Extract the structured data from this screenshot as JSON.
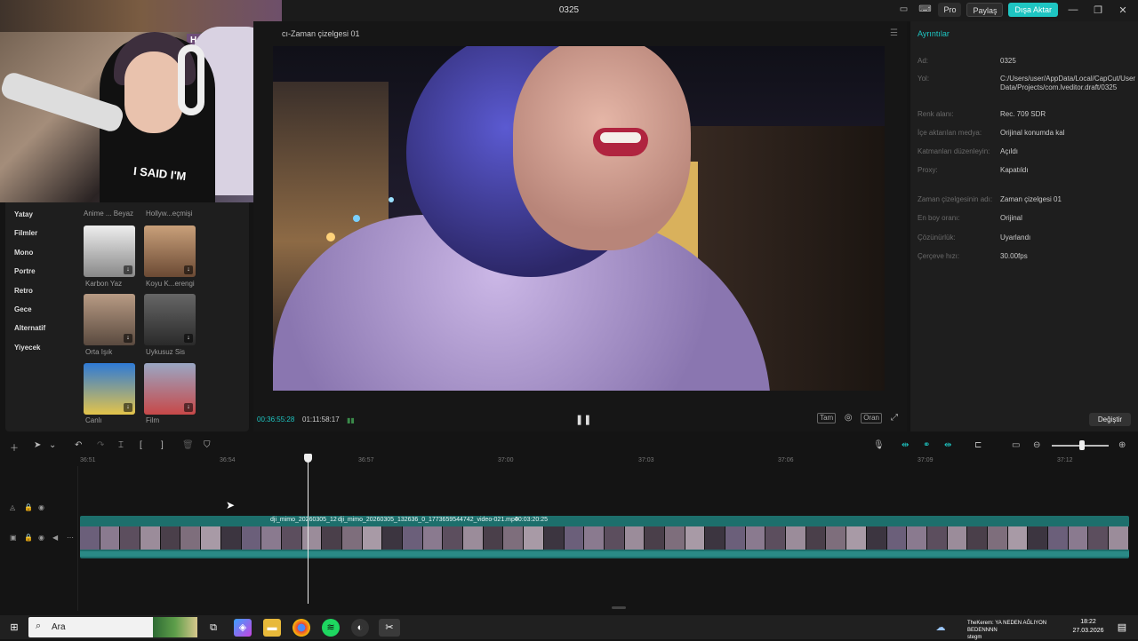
{
  "window": {
    "title": "0325",
    "pro_label": "Pro",
    "share_label": "Paylaş",
    "export_label": "Dışa Aktar"
  },
  "webcam": {
    "shirt_text": "I SAID I'M",
    "poster_text": "HAWK"
  },
  "filters": {
    "categories": [
      "Yatay",
      "Filmler",
      "Mono",
      "Portre",
      "Retro",
      "Gece",
      "Alternatif",
      "Yiyecek"
    ],
    "top_labels": [
      "Anime ... Beyaz",
      "Hollyw...eçmişi"
    ],
    "items": [
      {
        "label": "Karbon Yaz"
      },
      {
        "label": "Koyu K...erengi"
      },
      {
        "label": "Orta Işık"
      },
      {
        "label": "Uykusuz Sis"
      },
      {
        "label": "Canlı"
      },
      {
        "label": "Film"
      }
    ]
  },
  "preview": {
    "title": "cı-Zaman çizelgesi 01",
    "current_time": "00:36:55:28",
    "duration": "01:11:58:17",
    "full_label": "Tam",
    "ratio_label": "Oran"
  },
  "details": {
    "tab": "Ayrıntılar",
    "rows": [
      {
        "key": "Ad:",
        "value": "0325"
      },
      {
        "key": "Yol:",
        "value": "C:/Users/user/AppData/Local/CapCut/User Data/Projects/com.lveditor.draft/0325"
      },
      {
        "key": "Renk alanı:",
        "value": "Rec. 709 SDR"
      },
      {
        "key": "İçe aktarılan medya:",
        "value": "Orijinal konumda kal"
      },
      {
        "key": "Katmanları düzenleyin:",
        "value": "Açıldı"
      },
      {
        "key": "Proxy:",
        "value": "Kapatıldı"
      },
      {
        "key": "Zaman çizelgesinin adı:",
        "value": "Zaman çizelgesi 01"
      },
      {
        "key": "En boy oranı:",
        "value": "Orijinal"
      },
      {
        "key": "Çözünürlük:",
        "value": "Uyarlandı"
      },
      {
        "key": "Çerçeve hızı:",
        "value": "30.00fps"
      }
    ],
    "change_button": "Değiştir"
  },
  "timeline": {
    "ticks": [
      "36:51",
      "36:54",
      "36:57",
      "37:00",
      "37:03",
      "37:06",
      "37:09",
      "37:12"
    ],
    "clip_label_1": "dji_mimo_20260305_12",
    "clip_label_2": "dji_mimo_20260305_132636_0_1773659544742_video-021.mp4",
    "clip_duration": "00:03:20:25"
  },
  "taskbar": {
    "search_placeholder": "Ara",
    "notification": "TheKerem: YA NEDEN AĞLIYON BEDENNNN",
    "notification_sub": "stegm",
    "time": "18:22",
    "date": "27.03.2026"
  }
}
